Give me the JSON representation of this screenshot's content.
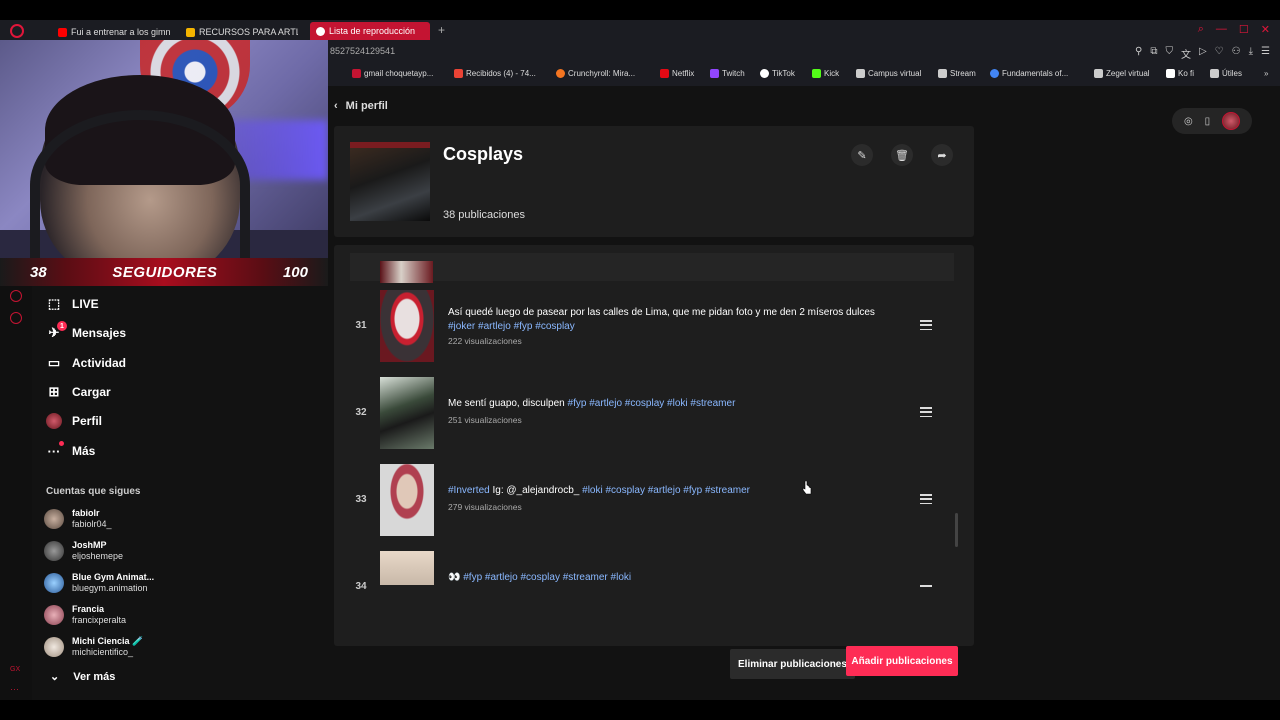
{
  "browser": {
    "tabs": [
      {
        "label": "Fui a entrenar a los gimna",
        "fav": "#ff0000"
      },
      {
        "label": "RECURSOS PARA ARTLE",
        "fav": "#f4b400"
      },
      {
        "label": "Lista de reproducción",
        "fav": "#ffffff"
      }
    ],
    "url": "8527524129541",
    "bookmarks": [
      {
        "label": "gmail choquetayp...",
        "fav": "#c41432"
      },
      {
        "label": "Recibidos (4) - 74...",
        "fav": "#ea4335"
      },
      {
        "label": "Crunchyroll: Mira...",
        "fav": "#f47521"
      },
      {
        "label": "Netflix",
        "fav": "#e50914"
      },
      {
        "label": "Twitch",
        "fav": "#9146ff"
      },
      {
        "label": "TikTok",
        "fav": "#ffffff"
      },
      {
        "label": "Kick",
        "fav": "#53fc18"
      },
      {
        "label": "Campus virtual",
        "fav": "#cccccc"
      },
      {
        "label": "Stream",
        "fav": "#cccccc"
      },
      {
        "label": "Fundamentals of...",
        "fav": "#4285f4"
      },
      {
        "label": "Zegel virtual",
        "fav": "#cccccc"
      },
      {
        "label": "Ko fi",
        "fav": "#ffffff"
      },
      {
        "label": "Útiles",
        "fav": "#cccccc"
      }
    ]
  },
  "overlay": {
    "followers_current": "38",
    "followers_label": "SEGUIDORES",
    "followers_goal": "100"
  },
  "sidebar": {
    "nav": [
      {
        "label": "LIVE",
        "icon": "live-icon"
      },
      {
        "label": "Mensajes",
        "icon": "inbox-icon",
        "badge": "1"
      },
      {
        "label": "Actividad",
        "icon": "activity-icon"
      },
      {
        "label": "Cargar",
        "icon": "upload-icon"
      },
      {
        "label": "Perfil",
        "icon": "profile-avatar"
      },
      {
        "label": "Más",
        "icon": "more-icon"
      }
    ],
    "following_title": "Cuentas que sigues",
    "following": [
      {
        "name": "fabiolr",
        "handle": "fabiolr04_",
        "color": "#8a7a6a"
      },
      {
        "name": "JoshMP",
        "handle": "eljoshemepe",
        "color": "#555555"
      },
      {
        "name": "Blue Gym Animat...",
        "handle": "bluegym.animation",
        "color": "#3a6aa8"
      },
      {
        "name": "Francia",
        "handle": "francixperalta",
        "color": "#b06070"
      },
      {
        "name": "Michi Ciencia 🧪",
        "handle": "michicientifico_",
        "color": "#c8b8a8"
      }
    ],
    "see_more": "Ver más"
  },
  "main": {
    "back_label": "Mi perfil",
    "playlist_title": "Cosplays",
    "pub_count": "38 publicaciones",
    "rows": [
      {
        "num": "31",
        "text": "Así quedé luego de pasear por las calles de Lima, que me pidan foto y me den 2 míseros dulces",
        "tags": "#joker #artlejo #fyp #cosplay",
        "views": "222 visualizaciones"
      },
      {
        "num": "32",
        "text": "Me sentí guapo, disculpen",
        "tags": "#fyp #artlejo #cosplay #loki #streamer",
        "views": "251 visualizaciones"
      },
      {
        "num": "33",
        "text_pre_tag": "#Inverted",
        "text": " Ig: @_alejandrocb_",
        "tags": "#loki #cosplay #artlejo #fyp #streamer",
        "views": "279 visualizaciones"
      },
      {
        "num": "34",
        "emoji": "👀",
        "tags": "#fyp #artlejo #cosplay #streamer #loki"
      }
    ],
    "delete_label": "Eliminar publicaciones",
    "add_label": "Añadir publicaciones"
  }
}
